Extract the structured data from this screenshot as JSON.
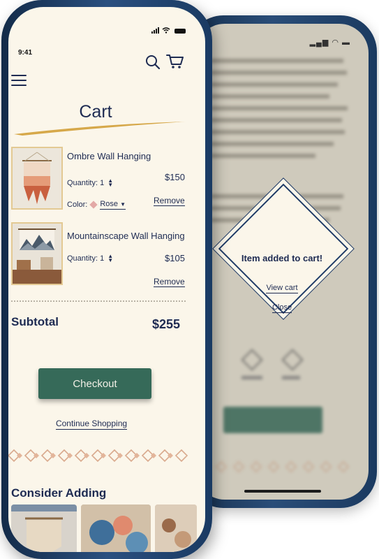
{
  "status": {
    "time": "9:41"
  },
  "header": {
    "title": "Cart",
    "icons": [
      "menu-icon",
      "search-icon",
      "cart-icon"
    ]
  },
  "cart_items": [
    {
      "name": "Ombre Wall Hanging",
      "quantity_label": "Quantity:",
      "quantity": "1",
      "price": "$150",
      "color_label": "Color:",
      "color_value": "Rose",
      "remove_label": "Remove"
    },
    {
      "name": "Mountainscape Wall Hanging",
      "quantity_label": "Quantity:",
      "quantity": "1",
      "price": "$105",
      "remove_label": "Remove"
    }
  ],
  "summary": {
    "subtotal_label": "Subtotal",
    "subtotal_value": "$255"
  },
  "actions": {
    "checkout_label": "Checkout",
    "continue_label": "Continue Shopping"
  },
  "suggestions": {
    "title": "Consider Adding"
  },
  "modal": {
    "title": "Item added to cart!",
    "view_cart": "View cart",
    "close": "Close"
  },
  "colors": {
    "navy": "#1e2b52",
    "cream": "#fbf6ea",
    "green": "#366a59",
    "gold": "#d6a84a",
    "phone_frame": "#1f3d63"
  }
}
